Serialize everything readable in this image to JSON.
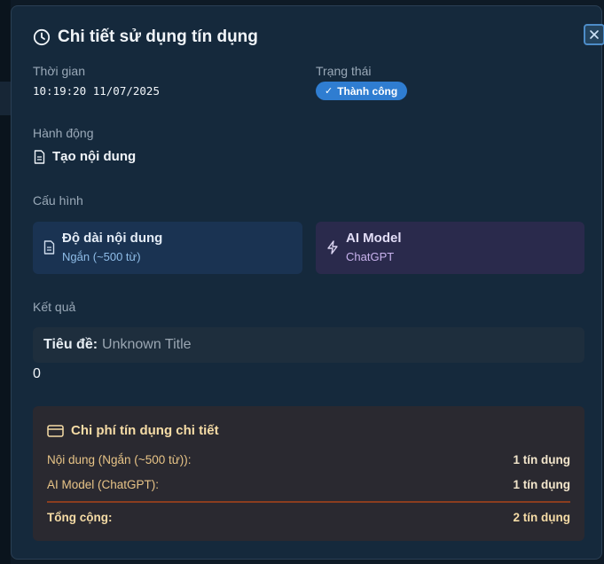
{
  "modal": {
    "title": "Chi tiết sử dụng tín dụng",
    "close_icon": "close-icon",
    "time": {
      "label": "Thời gian",
      "value": "10:19:20 11/07/2025"
    },
    "status": {
      "label": "Trạng thái",
      "value": "Thành công",
      "color": "#2f7dd1"
    },
    "action": {
      "label": "Hành động",
      "value": "Tạo nội dung",
      "icon": "document-icon"
    },
    "config": {
      "label": "Cấu hình",
      "content_length": {
        "title": "Độ dài nội dung",
        "value": "Ngắn (~500 từ)",
        "icon": "document-icon",
        "color": "#1a3352"
      },
      "ai_model": {
        "title": "AI Model",
        "value": "ChatGPT",
        "icon": "lightning-icon",
        "color": "#2a2a4c"
      }
    },
    "result": {
      "label": "Kết quả",
      "title_key": "Tiêu đề:",
      "title_value": "Unknown Title",
      "count": "0"
    },
    "cost": {
      "title": "Chi phí tín dụng chi tiết",
      "icon": "credit-card-icon",
      "rows": [
        {
          "label": "Nội dung (Ngắn (~500 từ)):",
          "amount": "1 tín dụng"
        },
        {
          "label": "AI Model (ChatGPT):",
          "amount": "1 tín dụng"
        }
      ],
      "total": {
        "label": "Tổng cộng:",
        "amount": "2 tín dụng"
      },
      "accent_color": "#f6dca6"
    }
  }
}
